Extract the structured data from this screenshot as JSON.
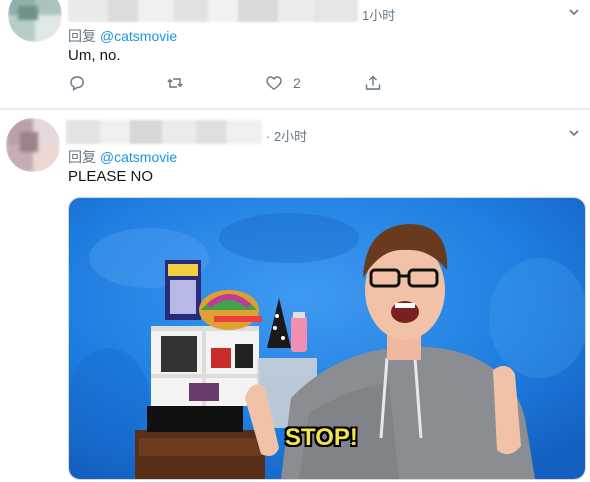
{
  "tweets": [
    {
      "time": "1小时",
      "reply_prefix": "回复",
      "reply_handle": "@catsmovie",
      "text": "Um, no.",
      "actions": {
        "reply_icon": "reply-icon",
        "retweet_icon": "retweet-icon",
        "like_icon": "heart-icon",
        "like_count": "2",
        "share_icon": "share-icon"
      },
      "menu_icon": "chevron-down-icon"
    },
    {
      "time": "· 2小时",
      "reply_prefix": "回复",
      "reply_handle": "@catsmovie",
      "text": "PLEASE NO",
      "media": {
        "caption": "STOP!",
        "background_color": "#1f7ee0"
      },
      "menu_icon": "chevron-down-icon"
    }
  ],
  "colors": {
    "link": "#1b95e0",
    "secondary_text": "#657786",
    "divider": "#e6ecf0"
  }
}
